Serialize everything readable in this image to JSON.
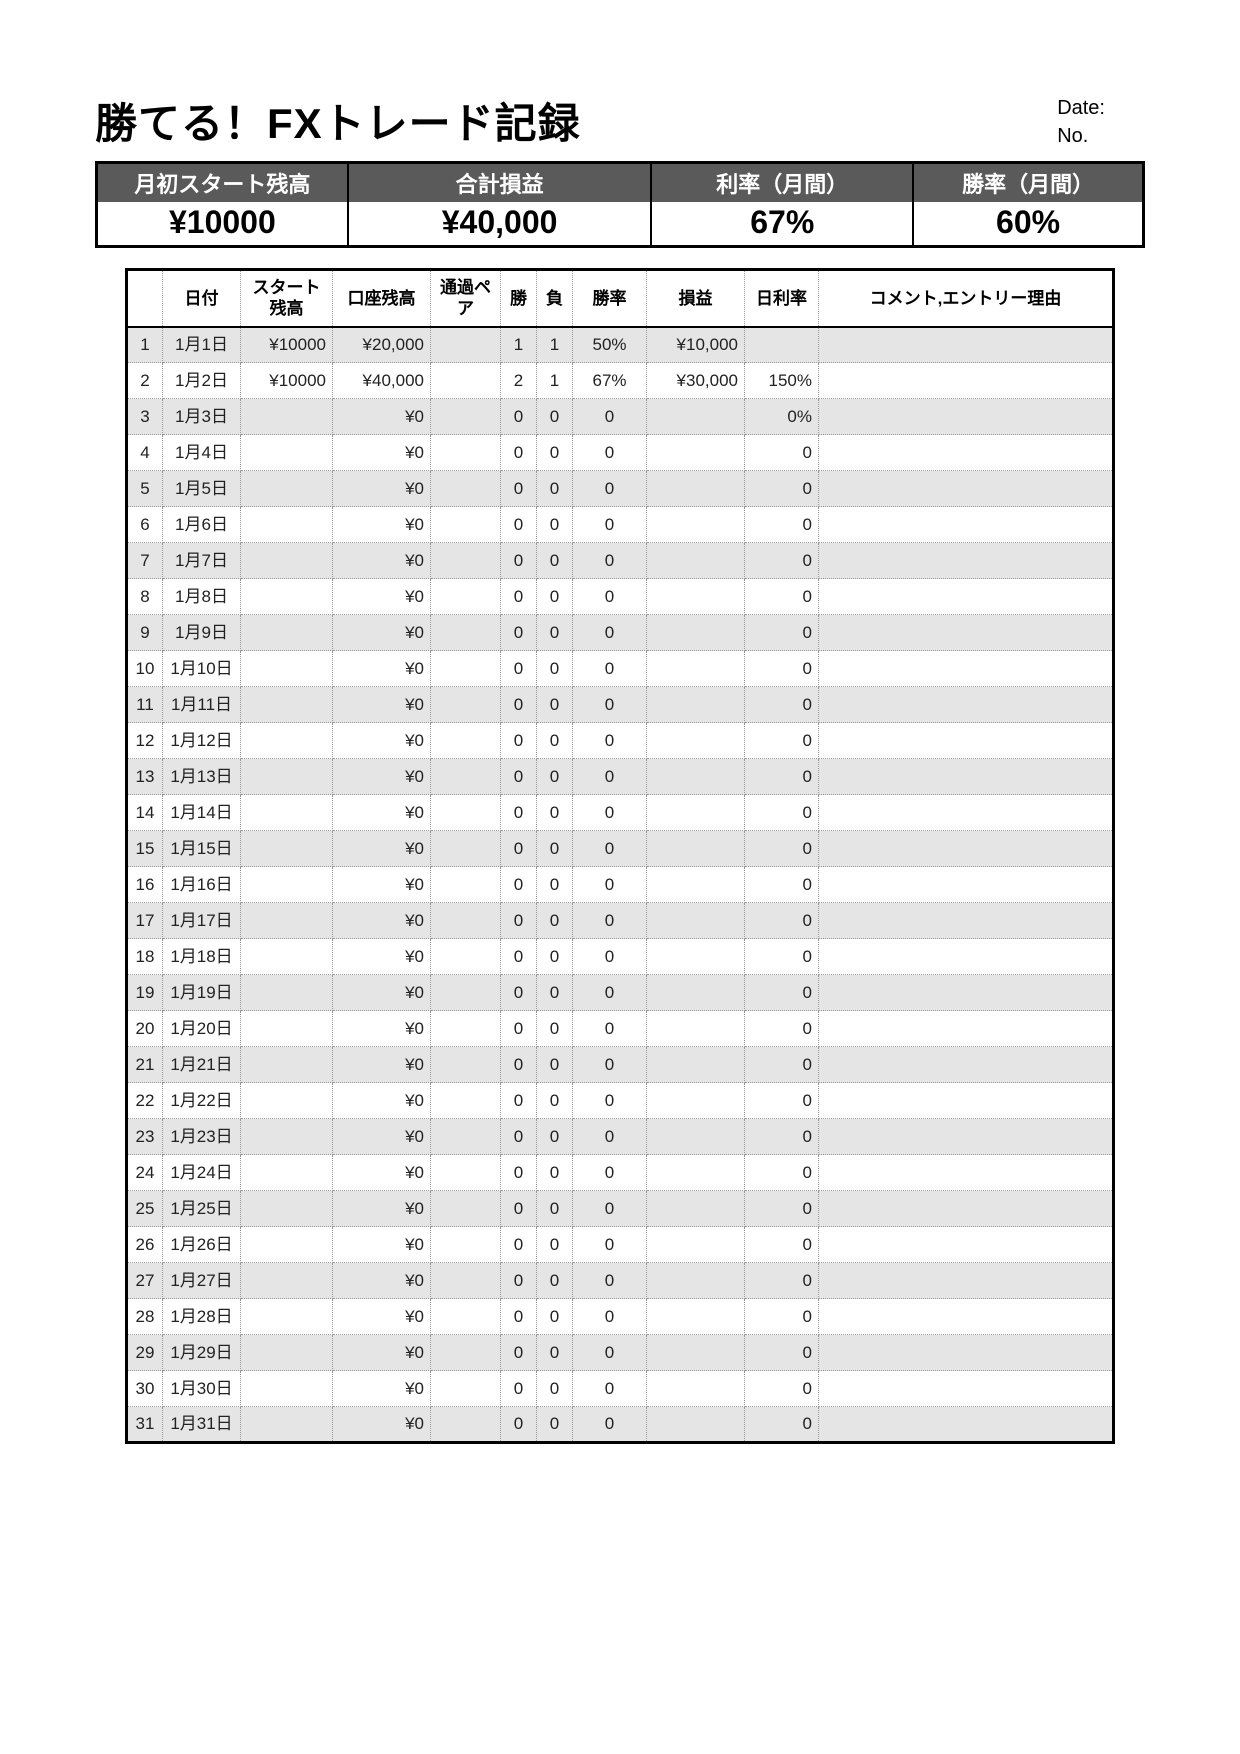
{
  "header": {
    "title": "勝てる！FXトレード記録",
    "date_label": "Date:",
    "no_label": "No."
  },
  "summary": {
    "labels": {
      "start_balance": "月初スタート残高",
      "total_pl": "合計損益",
      "rate_month": "利率（月間）",
      "win_month": "勝率（月間）"
    },
    "values": {
      "start_balance": "¥10000",
      "total_pl": "¥40,000",
      "rate_month": "67%",
      "win_month": "60%"
    }
  },
  "columns": {
    "idx": "",
    "date": "日付",
    "start": "スタート残高",
    "balance": "口座残高",
    "pair": "通過ペア",
    "win": "勝",
    "lose": "負",
    "rate": "勝率",
    "pl": "損益",
    "daily": "日利率",
    "comment": "コメント,エントリー理由"
  },
  "rows": [
    {
      "idx": "1",
      "date": "1月1日",
      "start": "¥10000",
      "balance": "¥20,000",
      "pair": "",
      "win": "1",
      "lose": "1",
      "rate": "50%",
      "pl": "¥10,000",
      "daily": "",
      "comment": ""
    },
    {
      "idx": "2",
      "date": "1月2日",
      "start": "¥10000",
      "balance": "¥40,000",
      "pair": "",
      "win": "2",
      "lose": "1",
      "rate": "67%",
      "pl": "¥30,000",
      "daily": "150%",
      "comment": ""
    },
    {
      "idx": "3",
      "date": "1月3日",
      "start": "",
      "balance": "¥0",
      "pair": "",
      "win": "0",
      "lose": "0",
      "rate": "0",
      "pl": "",
      "daily": "0%",
      "comment": ""
    },
    {
      "idx": "4",
      "date": "1月4日",
      "start": "",
      "balance": "¥0",
      "pair": "",
      "win": "0",
      "lose": "0",
      "rate": "0",
      "pl": "",
      "daily": "0",
      "comment": ""
    },
    {
      "idx": "5",
      "date": "1月5日",
      "start": "",
      "balance": "¥0",
      "pair": "",
      "win": "0",
      "lose": "0",
      "rate": "0",
      "pl": "",
      "daily": "0",
      "comment": ""
    },
    {
      "idx": "6",
      "date": "1月6日",
      "start": "",
      "balance": "¥0",
      "pair": "",
      "win": "0",
      "lose": "0",
      "rate": "0",
      "pl": "",
      "daily": "0",
      "comment": ""
    },
    {
      "idx": "7",
      "date": "1月7日",
      "start": "",
      "balance": "¥0",
      "pair": "",
      "win": "0",
      "lose": "0",
      "rate": "0",
      "pl": "",
      "daily": "0",
      "comment": ""
    },
    {
      "idx": "8",
      "date": "1月8日",
      "start": "",
      "balance": "¥0",
      "pair": "",
      "win": "0",
      "lose": "0",
      "rate": "0",
      "pl": "",
      "daily": "0",
      "comment": ""
    },
    {
      "idx": "9",
      "date": "1月9日",
      "start": "",
      "balance": "¥0",
      "pair": "",
      "win": "0",
      "lose": "0",
      "rate": "0",
      "pl": "",
      "daily": "0",
      "comment": ""
    },
    {
      "idx": "10",
      "date": "1月10日",
      "start": "",
      "balance": "¥0",
      "pair": "",
      "win": "0",
      "lose": "0",
      "rate": "0",
      "pl": "",
      "daily": "0",
      "comment": ""
    },
    {
      "idx": "11",
      "date": "1月11日",
      "start": "",
      "balance": "¥0",
      "pair": "",
      "win": "0",
      "lose": "0",
      "rate": "0",
      "pl": "",
      "daily": "0",
      "comment": ""
    },
    {
      "idx": "12",
      "date": "1月12日",
      "start": "",
      "balance": "¥0",
      "pair": "",
      "win": "0",
      "lose": "0",
      "rate": "0",
      "pl": "",
      "daily": "0",
      "comment": ""
    },
    {
      "idx": "13",
      "date": "1月13日",
      "start": "",
      "balance": "¥0",
      "pair": "",
      "win": "0",
      "lose": "0",
      "rate": "0",
      "pl": "",
      "daily": "0",
      "comment": ""
    },
    {
      "idx": "14",
      "date": "1月14日",
      "start": "",
      "balance": "¥0",
      "pair": "",
      "win": "0",
      "lose": "0",
      "rate": "0",
      "pl": "",
      "daily": "0",
      "comment": ""
    },
    {
      "idx": "15",
      "date": "1月15日",
      "start": "",
      "balance": "¥0",
      "pair": "",
      "win": "0",
      "lose": "0",
      "rate": "0",
      "pl": "",
      "daily": "0",
      "comment": ""
    },
    {
      "idx": "16",
      "date": "1月16日",
      "start": "",
      "balance": "¥0",
      "pair": "",
      "win": "0",
      "lose": "0",
      "rate": "0",
      "pl": "",
      "daily": "0",
      "comment": ""
    },
    {
      "idx": "17",
      "date": "1月17日",
      "start": "",
      "balance": "¥0",
      "pair": "",
      "win": "0",
      "lose": "0",
      "rate": "0",
      "pl": "",
      "daily": "0",
      "comment": ""
    },
    {
      "idx": "18",
      "date": "1月18日",
      "start": "",
      "balance": "¥0",
      "pair": "",
      "win": "0",
      "lose": "0",
      "rate": "0",
      "pl": "",
      "daily": "0",
      "comment": ""
    },
    {
      "idx": "19",
      "date": "1月19日",
      "start": "",
      "balance": "¥0",
      "pair": "",
      "win": "0",
      "lose": "0",
      "rate": "0",
      "pl": "",
      "daily": "0",
      "comment": ""
    },
    {
      "idx": "20",
      "date": "1月20日",
      "start": "",
      "balance": "¥0",
      "pair": "",
      "win": "0",
      "lose": "0",
      "rate": "0",
      "pl": "",
      "daily": "0",
      "comment": ""
    },
    {
      "idx": "21",
      "date": "1月21日",
      "start": "",
      "balance": "¥0",
      "pair": "",
      "win": "0",
      "lose": "0",
      "rate": "0",
      "pl": "",
      "daily": "0",
      "comment": ""
    },
    {
      "idx": "22",
      "date": "1月22日",
      "start": "",
      "balance": "¥0",
      "pair": "",
      "win": "0",
      "lose": "0",
      "rate": "0",
      "pl": "",
      "daily": "0",
      "comment": ""
    },
    {
      "idx": "23",
      "date": "1月23日",
      "start": "",
      "balance": "¥0",
      "pair": "",
      "win": "0",
      "lose": "0",
      "rate": "0",
      "pl": "",
      "daily": "0",
      "comment": ""
    },
    {
      "idx": "24",
      "date": "1月24日",
      "start": "",
      "balance": "¥0",
      "pair": "",
      "win": "0",
      "lose": "0",
      "rate": "0",
      "pl": "",
      "daily": "0",
      "comment": ""
    },
    {
      "idx": "25",
      "date": "1月25日",
      "start": "",
      "balance": "¥0",
      "pair": "",
      "win": "0",
      "lose": "0",
      "rate": "0",
      "pl": "",
      "daily": "0",
      "comment": ""
    },
    {
      "idx": "26",
      "date": "1月26日",
      "start": "",
      "balance": "¥0",
      "pair": "",
      "win": "0",
      "lose": "0",
      "rate": "0",
      "pl": "",
      "daily": "0",
      "comment": ""
    },
    {
      "idx": "27",
      "date": "1月27日",
      "start": "",
      "balance": "¥0",
      "pair": "",
      "win": "0",
      "lose": "0",
      "rate": "0",
      "pl": "",
      "daily": "0",
      "comment": ""
    },
    {
      "idx": "28",
      "date": "1月28日",
      "start": "",
      "balance": "¥0",
      "pair": "",
      "win": "0",
      "lose": "0",
      "rate": "0",
      "pl": "",
      "daily": "0",
      "comment": ""
    },
    {
      "idx": "29",
      "date": "1月29日",
      "start": "",
      "balance": "¥0",
      "pair": "",
      "win": "0",
      "lose": "0",
      "rate": "0",
      "pl": "",
      "daily": "0",
      "comment": ""
    },
    {
      "idx": "30",
      "date": "1月30日",
      "start": "",
      "balance": "¥0",
      "pair": "",
      "win": "0",
      "lose": "0",
      "rate": "0",
      "pl": "",
      "daily": "0",
      "comment": ""
    },
    {
      "idx": "31",
      "date": "1月31日",
      "start": "",
      "balance": "¥0",
      "pair": "",
      "win": "0",
      "lose": "0",
      "rate": "0",
      "pl": "",
      "daily": "0",
      "comment": ""
    }
  ]
}
